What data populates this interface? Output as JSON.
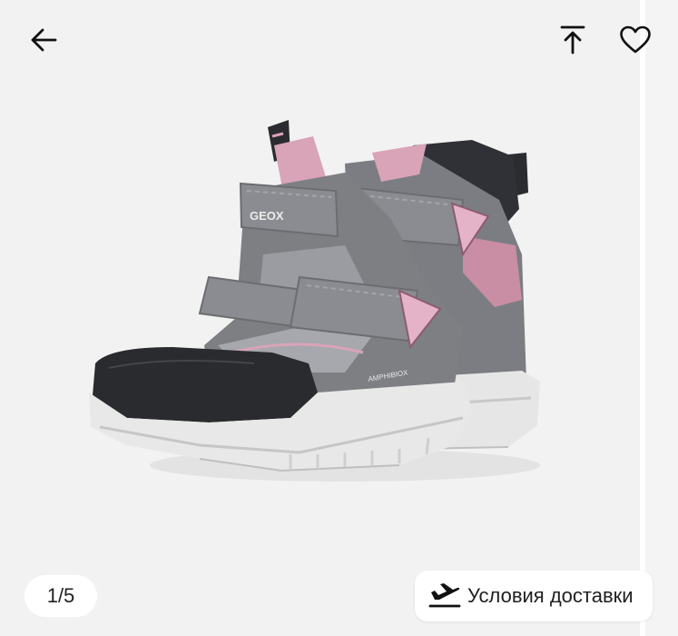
{
  "header": {
    "back_icon": "arrow-left-icon",
    "share_icon": "share-upload-icon",
    "favorite_icon": "heart-outline-icon"
  },
  "gallery": {
    "counter": "1/5",
    "image_subject": "kids winter boots",
    "brand_text": "GEOX",
    "tech_text": "AMPHIBIOX",
    "colors": {
      "upper": "#7d7f83",
      "upper_dark": "#6b6d71",
      "accent_pink": "#d9a3b8",
      "toe": "#2a2b2e",
      "sole": "#e6e6e6",
      "background": "#f2f2f2"
    }
  },
  "delivery": {
    "icon": "airplane-takeoff-icon",
    "label": "Условия доставки"
  }
}
